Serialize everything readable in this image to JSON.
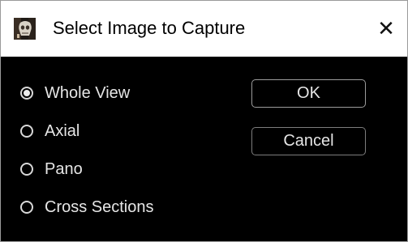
{
  "dialog": {
    "title": "Select Image to Capture",
    "close_glyph": "✕",
    "icon": "app-skull-icon"
  },
  "options": [
    {
      "label": "Whole View",
      "selected": true
    },
    {
      "label": "Axial",
      "selected": false
    },
    {
      "label": "Pano",
      "selected": false
    },
    {
      "label": "Cross Sections",
      "selected": false
    }
  ],
  "buttons": {
    "ok_label": "OK",
    "cancel_label": "Cancel"
  },
  "colors": {
    "background": "#000000",
    "titlebar": "#ffffff",
    "text": "#e6e6e6"
  }
}
